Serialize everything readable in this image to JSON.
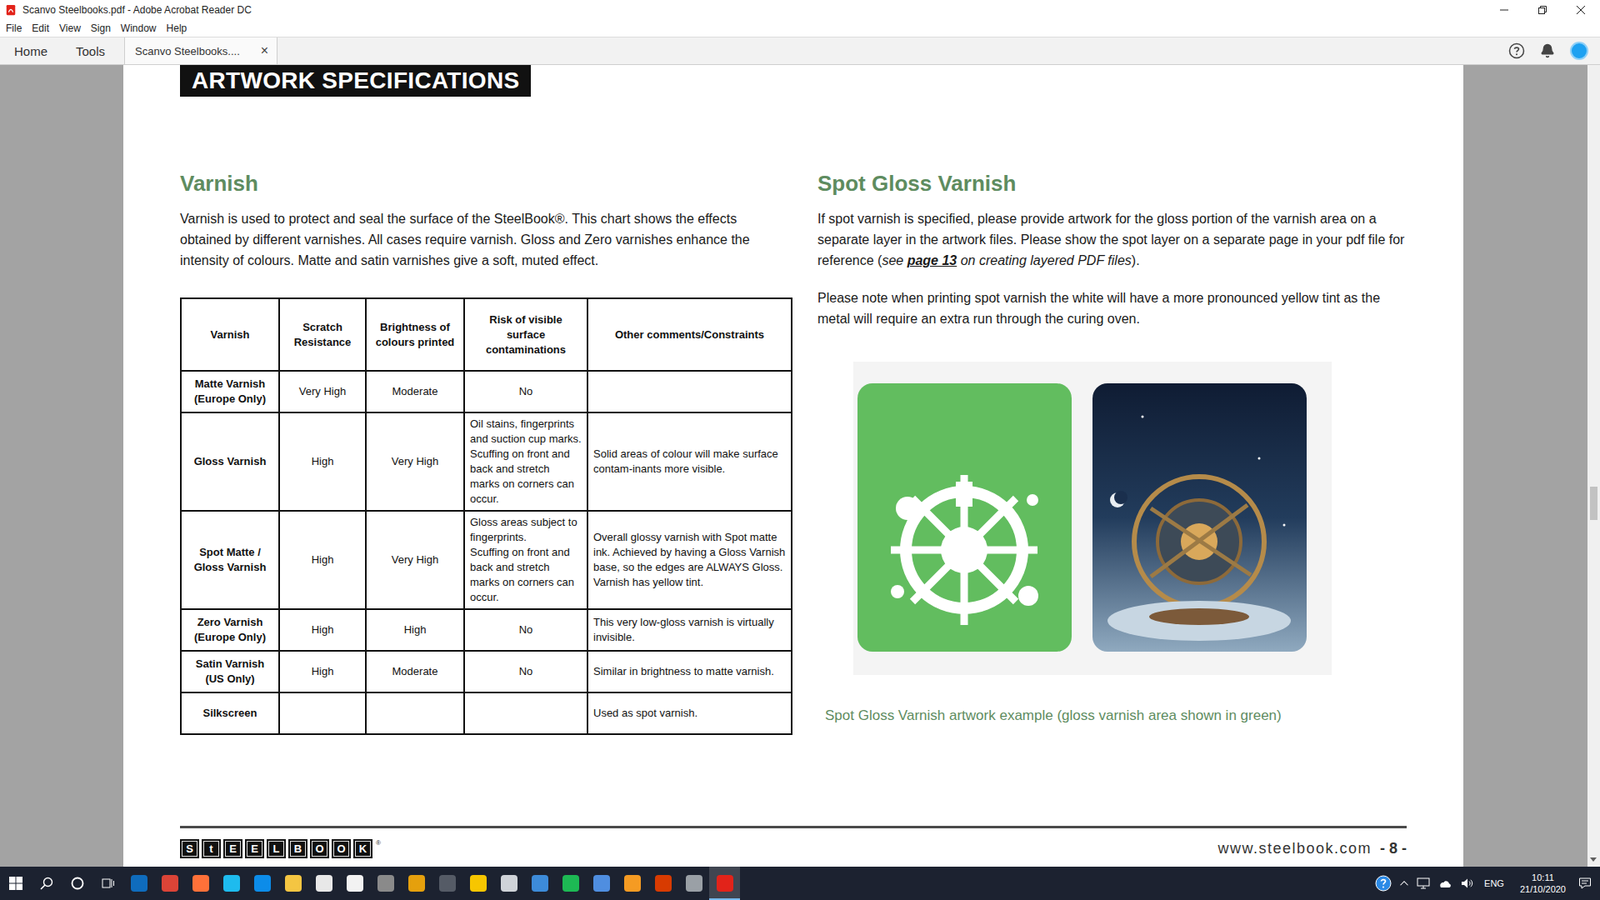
{
  "window": {
    "title": "Scanvo Steelbooks.pdf - Adobe Acrobat Reader DC"
  },
  "menu": [
    "File",
    "Edit",
    "View",
    "Sign",
    "Window",
    "Help"
  ],
  "tabs": [
    {
      "label": "Home",
      "selected": false
    },
    {
      "label": "Tools",
      "selected": false
    },
    {
      "label": "Scanvo Steelbooks....",
      "selected": true,
      "close": "×"
    }
  ],
  "page": {
    "banner": "ARTWORK SPECIFICATIONS",
    "left": {
      "heading": "Varnish",
      "text": "Varnish is used to protect and seal the surface of the SteelBook®. This chart shows the effects obtained by different varnishes. All cases require varnish. Gloss and Zero varnishes enhance the intensity of colours. Matte and satin varnishes give a soft, muted effect.",
      "table": {
        "columns": [
          "Varnish",
          "Scratch Resistance",
          "Brightness of colours printed",
          "Risk of visible surface contaminations",
          "Other comments/Constraints"
        ],
        "rows": [
          [
            "Matte Varnish (Europe Only)",
            "Very High",
            "Moderate",
            "No",
            ""
          ],
          [
            "Gloss Varnish",
            "High",
            "Very High",
            "Oil stains, fingerprints and suction cup marks.\nScuffing  on front and back and stretch marks on corners can occur.",
            "Solid areas of colour will make surface contam-inants more visible."
          ],
          [
            "Spot Matte / Gloss Varnish",
            "High",
            "Very High",
            "Gloss areas subject to fingerprints.\nScuffing  on front and back and stretch marks on corners can occur.",
            "Overall glossy varnish with Spot matte ink. Achieved by having a Gloss Varnish base, so the edges are ALWAYS Gloss. Varnish has yellow tint."
          ],
          [
            "Zero Varnish (Europe Only)",
            "High",
            "High",
            "No",
            "This very low-gloss varnish is virtually invisible."
          ],
          [
            "Satin Varnish (US Only)",
            "High",
            "Moderate",
            "No",
            "Similar in brightness to matte varnish."
          ],
          [
            "Silkscreen",
            "",
            "",
            "",
            "Used as spot varnish."
          ]
        ]
      }
    },
    "right": {
      "heading": "Spot Gloss Varnish",
      "paragraphs": [
        [
          {
            "text": "If spot varnish is specified, please provide artwork for the gloss portion of the varnish area on a separate layer in the artwork files. Please show the spot layer on a separate page in your pdf file for reference (",
            "kind": "plain"
          },
          {
            "text": "see ",
            "kind": "italic"
          },
          {
            "text": "page 13",
            "kind": "link"
          },
          {
            "text": " on creating layered PDF files",
            "kind": "italic"
          },
          {
            "text": ").",
            "kind": "plain"
          }
        ],
        [
          {
            "text": "Please note when printing spot varnish the white will have a more pronounced yellow tint as the metal will require an extra run through the curing oven.",
            "kind": "plain"
          }
        ]
      ],
      "caption": "Spot Gloss Varnish artwork example (gloss varnish area shown in green)"
    },
    "footer": {
      "logo": [
        "S",
        "t",
        "E",
        "E",
        "L",
        "B",
        "O",
        "O",
        "K"
      ],
      "mark": "®",
      "url": "www.steelbook.com",
      "page_number": "- 8 -"
    }
  },
  "scrollbar": {
    "level": 0.55
  },
  "taskbar": {
    "apps": [
      {
        "color": "#0f6cbd",
        "selected": false
      },
      {
        "color": "#db4437",
        "selected": false
      },
      {
        "color": "#ff7139",
        "selected": false
      },
      {
        "color": "#1ebbee",
        "selected": false
      },
      {
        "color": "#0c8ce9",
        "selected": false
      },
      {
        "color": "#f4c542",
        "selected": false
      },
      {
        "color": "#e8e8e8",
        "selected": false
      },
      {
        "color": "#f2f2f2",
        "selected": false
      },
      {
        "color": "#8a8a8a",
        "selected": false
      },
      {
        "color": "#e5a00d",
        "selected": false
      },
      {
        "color": "#555b66",
        "selected": false
      },
      {
        "color": "#f7c600",
        "selected": false
      },
      {
        "color": "#cfd3d8",
        "selected": false
      },
      {
        "color": "#3d8bd9",
        "selected": false
      },
      {
        "color": "#1db954",
        "selected": false
      },
      {
        "color": "#4f8ee0",
        "selected": false
      },
      {
        "color": "#f59b23",
        "selected": false
      },
      {
        "color": "#d83b01",
        "selected": false
      },
      {
        "color": "#9aa0a6",
        "selected": false
      },
      {
        "color": "#e2231a",
        "selected": true
      }
    ],
    "language": "ENG",
    "time": "10:11",
    "date": "21/10/2020"
  }
}
